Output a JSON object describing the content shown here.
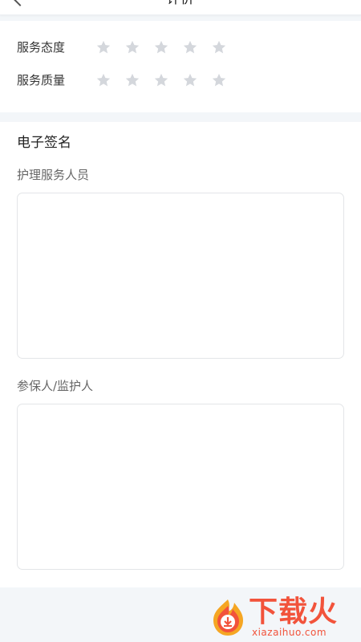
{
  "header": {
    "title": "评价",
    "back_icon": "chevron-left-icon"
  },
  "rating": {
    "rows": [
      {
        "label": "服务态度",
        "stars": 5,
        "selected": 0
      },
      {
        "label": "服务质量",
        "stars": 5,
        "selected": 0
      }
    ],
    "star_color": "#d4d7dc"
  },
  "signature": {
    "title": "电子签名",
    "fields": [
      {
        "label": "护理服务人员"
      },
      {
        "label": "参保人/监护人"
      }
    ]
  },
  "watermark": {
    "brand": "下载火",
    "site": "xiazaihuo.com",
    "color": "#f2533b"
  }
}
